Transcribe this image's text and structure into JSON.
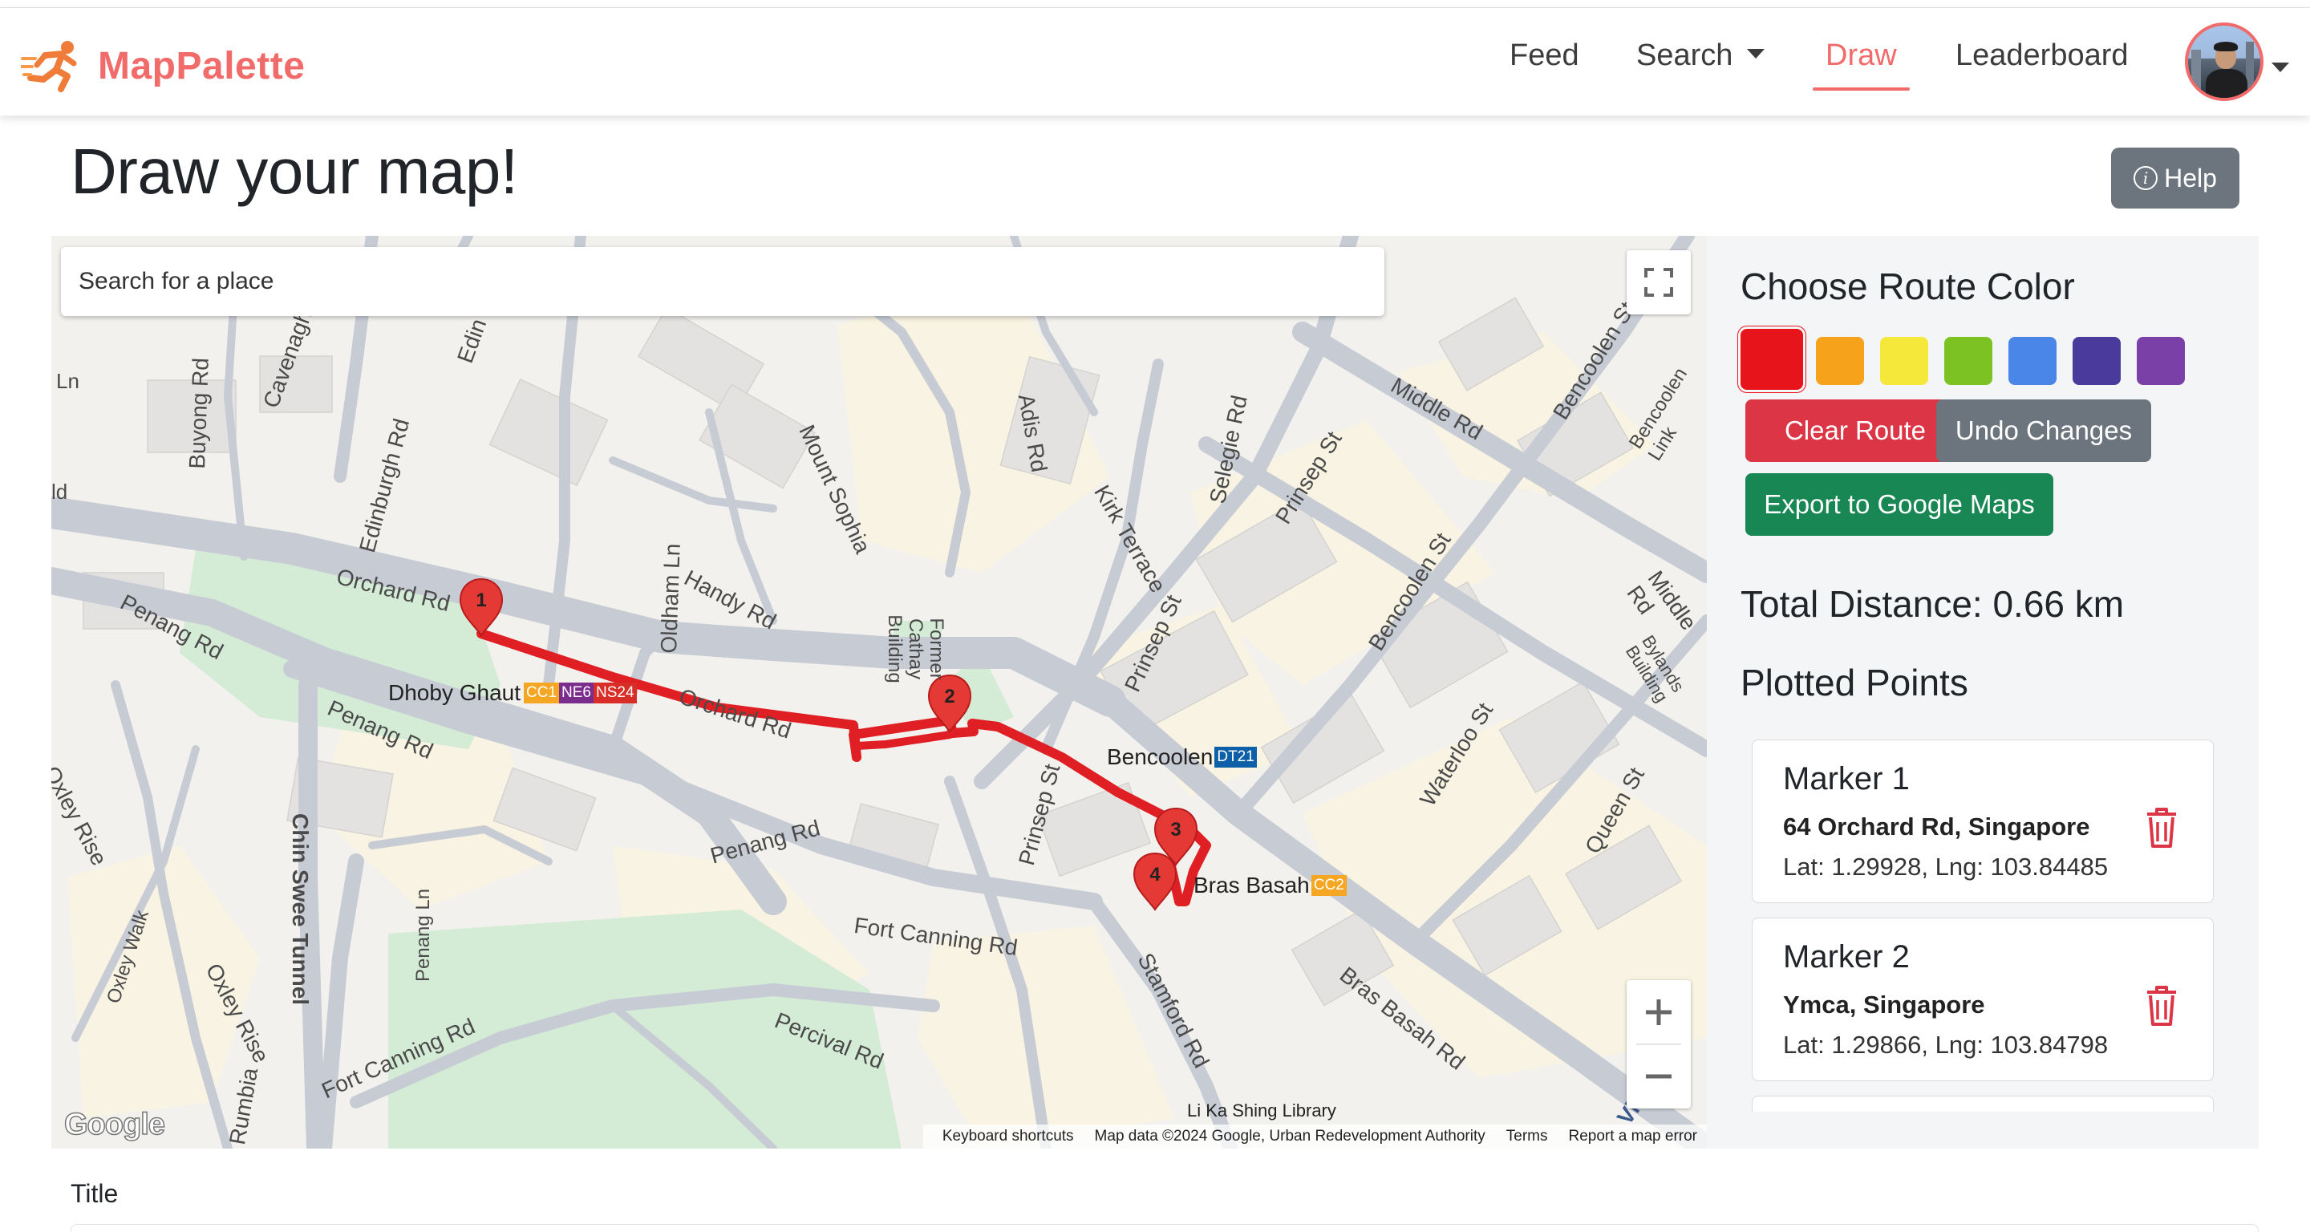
{
  "app": {
    "brand": "MapPalette",
    "brand_color": "#f26b6b"
  },
  "nav": {
    "items": [
      {
        "label": "Feed",
        "active": false
      },
      {
        "label": "Search",
        "active": false,
        "dropdown": true
      },
      {
        "label": "Draw",
        "active": true
      },
      {
        "label": "Leaderboard",
        "active": false
      }
    ],
    "avatar_icon": "user-avatar"
  },
  "page": {
    "title": "Draw your map!",
    "help_label": "Help"
  },
  "map": {
    "search_placeholder": "Search for a place",
    "route_color": "#e01f24",
    "street_labels": [
      "Orchard Rd",
      "Orchard Rd",
      "Penang Rd",
      "Penang Rd",
      "Penang Rd",
      "Buyong Rd",
      "Cavenagh",
      "Edinburgh Rd",
      "Edin",
      "Oldham Ln",
      "Handy Rd",
      "Mount Sophia",
      "Adis Rd",
      "Former Cathay Building",
      "Kirk Terrace",
      "Selegie Rd",
      "Prinsep St",
      "Prinsep St",
      "Prinsep St",
      "Middle Rd",
      "Middle Rd",
      "Bencoolen St",
      "Bencoolen St",
      "Bencoolen Link",
      "Bylands Building",
      "Waterloo St",
      "Queen St",
      "Bras Basah Rd",
      "Stamford Rd",
      "Fort Canning Rd",
      "Fort Canning Rd",
      "Percival Rd",
      "Oxley Rise",
      "Oxley Rise",
      "Oxley Walk",
      "Chin Swee Tunnel",
      "Penang Ln",
      "Rumbia",
      "Victori",
      "Li Ka Shing Library",
      "Ln",
      "ld"
    ],
    "stations": [
      {
        "name": "Dhoby Ghaut",
        "codes": [
          {
            "code": "CC1",
            "color": "#f5a623"
          },
          {
            "code": "NE6",
            "color": "#7b2d8e"
          },
          {
            "code": "NS24",
            "color": "#d92d27"
          }
        ]
      },
      {
        "name": "Bencoolen",
        "codes": [
          {
            "code": "DT21",
            "color": "#0d5fa8"
          }
        ]
      },
      {
        "name": "Bras Basah",
        "codes": [
          {
            "code": "CC2",
            "color": "#f5a623"
          }
        ]
      }
    ],
    "markers": [
      "1",
      "2",
      "3",
      "4"
    ],
    "attribution": {
      "shortcuts": "Keyboard shortcuts",
      "data": "Map data ©2024 Google, Urban Redevelopment Authority",
      "terms": "Terms",
      "report": "Report a map error"
    },
    "logo": "Google"
  },
  "panel": {
    "color_heading": "Choose Route Color",
    "colors": [
      {
        "name": "red",
        "hex": "#e8141b",
        "selected": true
      },
      {
        "name": "orange",
        "hex": "#f7a21b"
      },
      {
        "name": "yellow",
        "hex": "#f6e83a"
      },
      {
        "name": "green",
        "hex": "#7cc222"
      },
      {
        "name": "blue",
        "hex": "#4a86e8"
      },
      {
        "name": "indigo",
        "hex": "#4a3a9b"
      },
      {
        "name": "purple",
        "hex": "#7b3fa8"
      }
    ],
    "clear_label": "Clear Route",
    "undo_label": "Undo Changes",
    "export_label": "Export to Google Maps",
    "total_distance": "Total Distance: 0.66 km",
    "points_heading": "Plotted Points",
    "points": [
      {
        "name": "Marker 1",
        "address": "64 Orchard Rd, Singapore",
        "latlng": "Lat: 1.29928, Lng: 103.84485"
      },
      {
        "name": "Marker 2",
        "address": "Ymca, Singapore",
        "latlng": "Lat: 1.29866, Lng: 103.84798"
      }
    ]
  },
  "form": {
    "title_label": "Title"
  }
}
